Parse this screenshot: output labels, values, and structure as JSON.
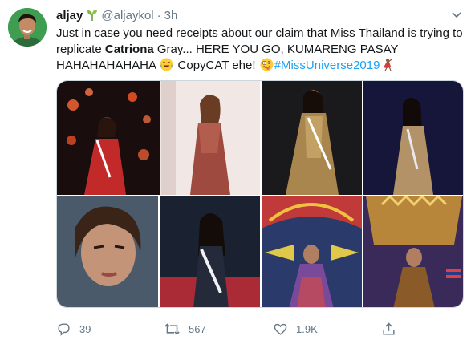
{
  "tweet": {
    "display_name": "aljay",
    "handle": "@aljaykol",
    "separator": "·",
    "time": "3h",
    "text": {
      "p1": "Just in case you need receipts about our claim that Miss Thailand is trying to replicate ",
      "bold": "Catriona",
      "p2": " Gray... HERE YOU GO, KUMARENG PASAY HAHAHAHAHAHA ",
      "p3": " CopyCAT ehe! ",
      "hashtag": "#MissUniverse2019"
    },
    "media": [
      {
        "description": "pageant-gown-red"
      },
      {
        "description": "pageant-gown-sequin"
      },
      {
        "description": "pageant-gown-gold"
      },
      {
        "description": "pageant-gown-thailand"
      }
    ],
    "actions": {
      "replies": "39",
      "retweets": "567",
      "likes": "1.9K"
    },
    "colors": {
      "text": "#14171a",
      "muted": "#657786",
      "link": "#1da1f2",
      "border": "#ccd6dd"
    },
    "icons": [
      "sprout-icon",
      "chevron-down-icon",
      "joy-emoji",
      "zany-face-emoji",
      "dancer-emoji",
      "reply-icon",
      "retweet-icon",
      "heart-icon",
      "share-icon"
    ]
  }
}
